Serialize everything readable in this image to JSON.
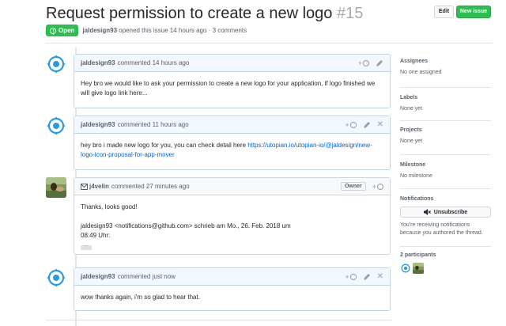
{
  "issue": {
    "title": "Request permission to create a new logo",
    "number": "#15",
    "status": "Open",
    "author": "jaldesign93",
    "opened_text": "opened this issue 14 hours ago · 3 comments"
  },
  "header_buttons": {
    "edit": "Edit",
    "new_issue": "New issue"
  },
  "comments": [
    {
      "author": "jaldesign93",
      "action": "commented 14 hours ago",
      "body": "Hey bro we would like to ask your permission to create a new logo for your application, if logo finished we will give logo link here..."
    },
    {
      "author": "jaldesign93",
      "action": "commented 11 hours ago",
      "body_prefix": "hey bro i made new logo for you, you can check detail here ",
      "link": "https://utopian.io/utopian-io/@jaldesign/new-logo-icon-proposal-for-app-mover"
    },
    {
      "author": "j4velin",
      "action": "commented 27 minutes ago",
      "role": "Owner",
      "body_line1": "Thanks, looks good!",
      "body_line2": "jaldesign93 <notifications@github.com> schrieb am Mo., 26. Feb. 2018 um",
      "body_line3": "08:49 Uhr:",
      "ellipsis": "···"
    },
    {
      "author": "jaldesign93",
      "action": "commented just now",
      "body": "wow thanks again, i'm so glad to hear that."
    }
  ],
  "reaction_label": "+",
  "sidebar": {
    "assignees": {
      "label": "Assignees",
      "value": "No one assigned"
    },
    "labels": {
      "label": "Labels",
      "value": "None yet"
    },
    "projects": {
      "label": "Projects",
      "value": "None yet"
    },
    "milestone": {
      "label": "Milestone",
      "value": "No milestone"
    },
    "notifications": {
      "label": "Notifications",
      "button": "Unsubscribe",
      "note": "You're receiving notifications because you authored the thread."
    },
    "participants": {
      "label": "2 participants"
    }
  },
  "colors": {
    "open_green": "#2cbe4e",
    "link_blue": "#0366d6",
    "comment_header_blue": "#f1f8ff",
    "logo_blue": "#2b9ae0"
  }
}
